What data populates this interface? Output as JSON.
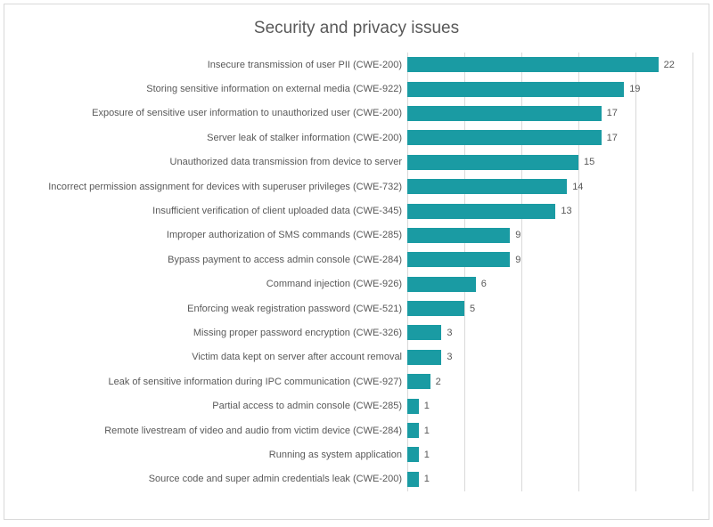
{
  "chart_data": {
    "type": "bar",
    "orientation": "horizontal",
    "title": "Security and privacy issues",
    "xlabel": "",
    "ylabel": "",
    "xlim": [
      0,
      25
    ],
    "x_gridlines": [
      0,
      5,
      10,
      15,
      20,
      25
    ],
    "bar_color": "#1a9ba3",
    "categories": [
      "Insecure transmission of user PII (CWE-200)",
      "Storing sensitive information on external media (CWE-922)",
      "Exposure of sensitive user information to unauthorized user (CWE-200)",
      "Server leak of stalker information (CWE-200)",
      "Unauthorized data transmission from device to server",
      "Incorrect permission assignment for devices with superuser privileges (CWE-732)",
      "Insufficient verification of client uploaded data (CWE-345)",
      "Improper authorization of SMS commands (CWE-285)",
      "Bypass payment to access admin console (CWE-284)",
      "Command injection (CWE-926)",
      "Enforcing weak registration password (CWE-521)",
      "Missing proper password encryption (CWE-326)",
      "Victim data kept on server after account removal",
      "Leak of sensitive information during IPC communication (CWE-927)",
      "Partial access to admin console (CWE-285)",
      "Remote livestream of video and audio from victim device (CWE-284)",
      "Running as system application",
      "Source code and super admin credentials leak (CWE-200)"
    ],
    "values": [
      22,
      19,
      17,
      17,
      15,
      14,
      13,
      9,
      9,
      6,
      5,
      3,
      3,
      2,
      1,
      1,
      1,
      1
    ]
  }
}
